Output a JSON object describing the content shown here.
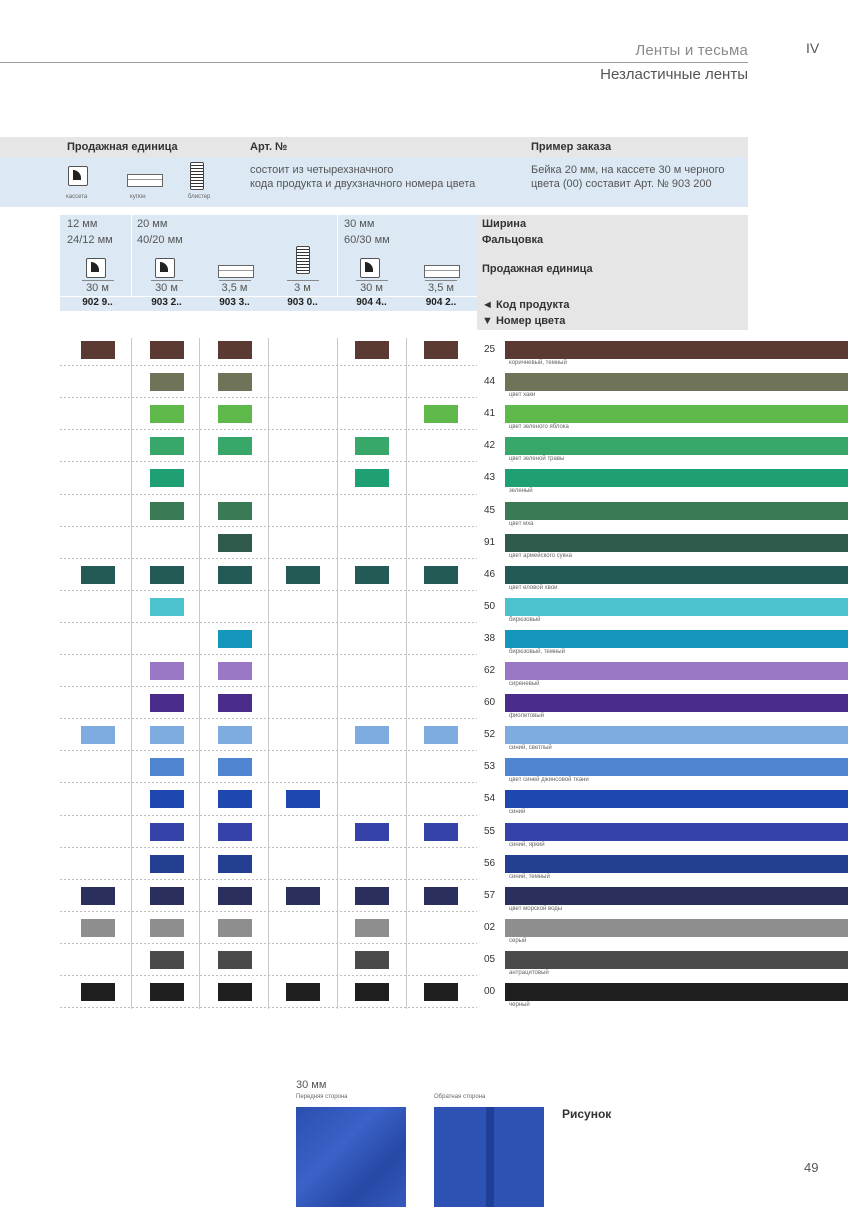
{
  "header": {
    "category": "Ленты и тесьма",
    "subtitle": "Незластичные ленты",
    "section": "IV",
    "page_number": "49"
  },
  "info": {
    "unit_header": "Продажная единица",
    "art_header": "Арт. №",
    "example_header": "Пример заказа",
    "icons": [
      {
        "icon": "cassette-icon",
        "label": "кассета"
      },
      {
        "icon": "coupon-icon",
        "label": "купон"
      },
      {
        "icon": "blister-icon",
        "label": "блистер"
      }
    ],
    "art_text_1": "состоит из четырехзначного",
    "art_text_2": "кода продукта и двухзначного номера цвета",
    "example_text_1": "Бейка 20 мм, на кассете 30 м черного",
    "example_text_2": "цвета (00) составит Арт. № 903 200"
  },
  "legend": {
    "width": "Ширина",
    "fold": "Фальцовка",
    "unit": "Продажная единица",
    "code": "◄ Код продукта",
    "color_no": "▼ Номер цвета"
  },
  "widths": [
    {
      "w": "12 мм",
      "f": "24/12 мм"
    },
    {
      "w": "20 мм",
      "f": "40/20 мм"
    },
    {
      "w": "30 мм",
      "f": "60/30 мм"
    }
  ],
  "columns": [
    {
      "icon": "cassette-icon",
      "len": "30 м",
      "code": "902 9.."
    },
    {
      "icon": "cassette-icon",
      "len": "30 м",
      "code": "903 2.."
    },
    {
      "icon": "coupon-icon",
      "len": "3,5 м",
      "code": "903 3.."
    },
    {
      "icon": "blister-icon",
      "len": "3 м",
      "code": "903 0.."
    },
    {
      "icon": "cassette-icon",
      "len": "30 м",
      "code": "904 4.."
    },
    {
      "icon": "coupon-icon",
      "len": "3,5 м",
      "code": "904 2.."
    }
  ],
  "colors": [
    {
      "no": "25",
      "name": "коричневый, темный",
      "hex": "#5a3a33",
      "avail": [
        1,
        1,
        1,
        0,
        1,
        1
      ]
    },
    {
      "no": "44",
      "name": "цвет хаки",
      "hex": "#6f7459",
      "avail": [
        0,
        1,
        1,
        0,
        0,
        0
      ]
    },
    {
      "no": "41",
      "name": "цвет зеленого яблока",
      "hex": "#5fb84a",
      "avail": [
        0,
        1,
        1,
        0,
        0,
        1
      ]
    },
    {
      "no": "42",
      "name": "цвет зеленой травы",
      "hex": "#37a86a",
      "avail": [
        0,
        1,
        1,
        0,
        1,
        0
      ]
    },
    {
      "no": "43",
      "name": "зеленый",
      "hex": "#1ea072",
      "avail": [
        0,
        1,
        0,
        0,
        1,
        0
      ]
    },
    {
      "no": "45",
      "name": "цвет мха",
      "hex": "#3a7a55",
      "avail": [
        0,
        1,
        1,
        0,
        0,
        0
      ]
    },
    {
      "no": "91",
      "name": "цвет армейского сукна",
      "hex": "#2f5a4c",
      "avail": [
        0,
        0,
        1,
        0,
        0,
        0
      ]
    },
    {
      "no": "46",
      "name": "цвет еловой хвои",
      "hex": "#245a55",
      "avail": [
        1,
        1,
        1,
        1,
        1,
        1
      ]
    },
    {
      "no": "50",
      "name": "бирюзовый",
      "hex": "#4cc2cf",
      "avail": [
        0,
        1,
        0,
        0,
        0,
        0
      ]
    },
    {
      "no": "38",
      "name": "бирюзовый, темный",
      "hex": "#1596bd",
      "avail": [
        0,
        0,
        1,
        0,
        0,
        0
      ]
    },
    {
      "no": "62",
      "name": "сиреневый",
      "hex": "#9b78c6",
      "avail": [
        0,
        1,
        1,
        0,
        0,
        0
      ]
    },
    {
      "no": "60",
      "name": "фиолетовый",
      "hex": "#4a2c8a",
      "avail": [
        0,
        1,
        1,
        0,
        0,
        0
      ]
    },
    {
      "no": "52",
      "name": "синий, светлый",
      "hex": "#7eabe0",
      "avail": [
        1,
        1,
        1,
        0,
        1,
        1
      ]
    },
    {
      "no": "53",
      "name": "цвет синей джинсовой ткани",
      "hex": "#4f85d0",
      "avail": [
        0,
        1,
        1,
        0,
        0,
        0
      ]
    },
    {
      "no": "54",
      "name": "синий",
      "hex": "#1f47b0",
      "avail": [
        0,
        1,
        1,
        1,
        0,
        0
      ]
    },
    {
      "no": "55",
      "name": "синий, яркий",
      "hex": "#3542a8",
      "avail": [
        0,
        1,
        1,
        0,
        1,
        1
      ]
    },
    {
      "no": "56",
      "name": "синий, темный",
      "hex": "#243e92",
      "avail": [
        0,
        1,
        1,
        0,
        0,
        0
      ]
    },
    {
      "no": "57",
      "name": "цвет морской воды",
      "hex": "#2a2f5e",
      "avail": [
        1,
        1,
        1,
        1,
        1,
        1
      ]
    },
    {
      "no": "02",
      "name": "серый",
      "hex": "#8e8e8e",
      "avail": [
        1,
        1,
        1,
        0,
        1,
        0
      ]
    },
    {
      "no": "05",
      "name": "антрацитовый",
      "hex": "#4a4a4a",
      "avail": [
        0,
        1,
        1,
        0,
        1,
        0
      ]
    },
    {
      "no": "00",
      "name": "черный",
      "hex": "#1e1e1e",
      "avail": [
        1,
        1,
        1,
        1,
        1,
        1
      ]
    }
  ],
  "figure": {
    "width": "30 мм",
    "front": "Передняя сторона",
    "back": "Обратная сторона",
    "caption": "Рисунок"
  }
}
